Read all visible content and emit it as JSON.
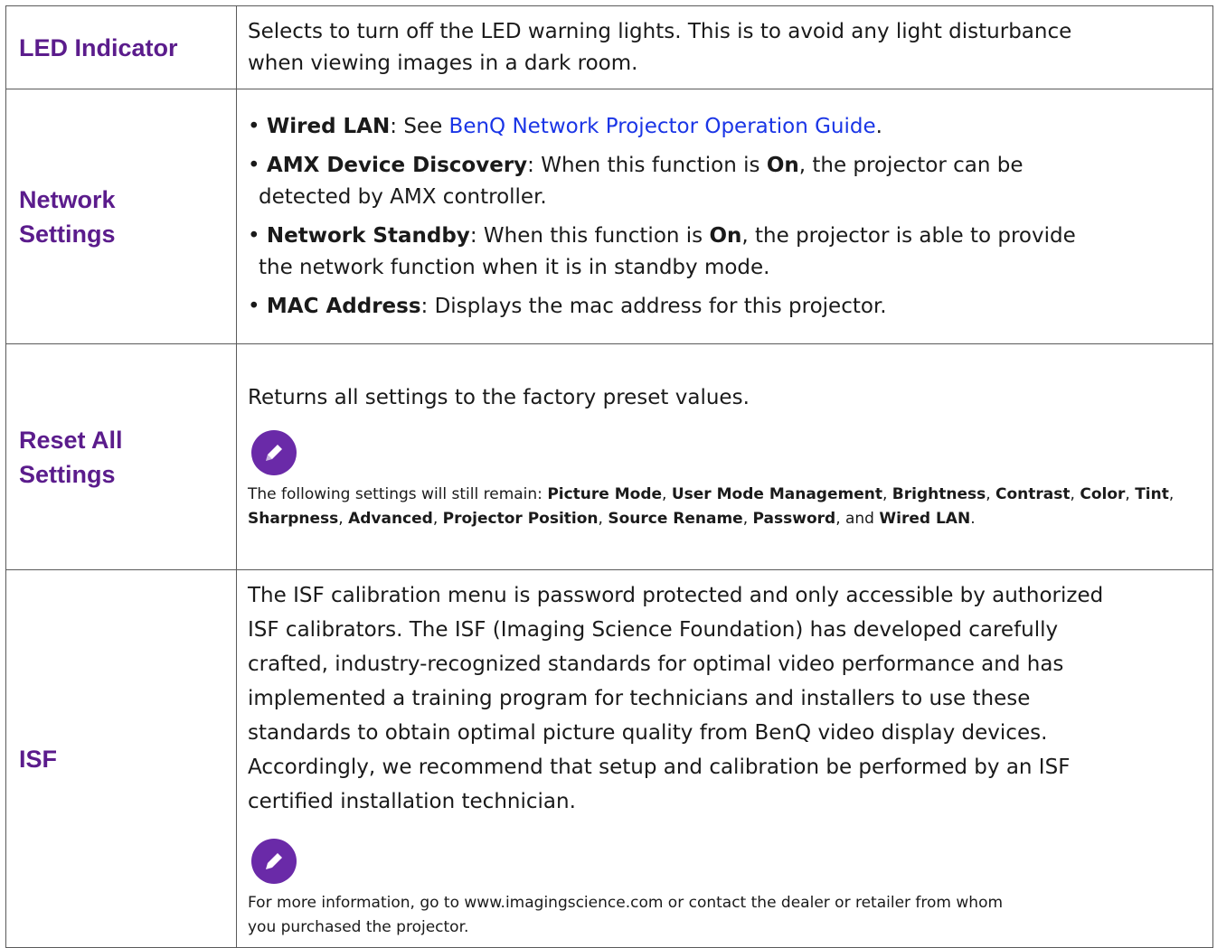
{
  "rows": {
    "led": {
      "label": "LED Indicator",
      "desc_line1": "Selects to turn off the LED warning lights. This is to avoid any light disturbance",
      "desc_line2": "when viewing images in a dark room."
    },
    "network": {
      "label_line1": "Network",
      "label_line2": "Settings",
      "wired": {
        "term": "Wired LAN",
        "text": ": See ",
        "link": "BenQ Network Projector Operation Guide",
        "end": "."
      },
      "amx": {
        "term": "AMX Device Discovery",
        "t1": ": When this function is ",
        "on": "On",
        "t2": ", the projector can be",
        "line2": "detected by AMX controller."
      },
      "standby": {
        "term": "Network Standby",
        "t1": ": When this function is ",
        "on": "On",
        "t2": ", the projector is able to provide",
        "line2": "the network function when it is in standby mode."
      },
      "mac": {
        "term": "MAC Address",
        "text": ": Displays the mac address for this projector."
      }
    },
    "reset": {
      "label_line1": "Reset All",
      "label_line2": "Settings",
      "intro": "Returns all settings to the factory preset values.",
      "note_icon": "pencil-icon",
      "note": {
        "prefix": "The following settings will still remain: ",
        "items": [
          "Picture Mode",
          "User Mode Management",
          "Brightness",
          "Contrast",
          "Color",
          "Tint",
          "Sharpness",
          "Advanced",
          "Projector Position",
          "Source Rename",
          "Password"
        ],
        "sep": ", ",
        "and": ", and ",
        "last": "Wired LAN",
        "end": "."
      }
    },
    "isf": {
      "label": "ISF",
      "lines": [
        "The ISF calibration menu is password protected and only accessible by authorized",
        "ISF calibrators. The ISF (Imaging Science Foundation) has developed carefully",
        "crafted, industry-recognized standards for optimal video performance and has",
        "implemented a training program for technicians and installers to use these",
        "standards to obtain optimal picture quality from BenQ video display devices.",
        "Accordingly, we recommend that setup and calibration be performed by an ISF",
        "certified installation technician."
      ],
      "note_icon": "pencil-icon",
      "note_line1": "For more information, go to www.imagingscience.com or contact the dealer or retailer from whom",
      "note_line2": "you purchased the projector."
    }
  },
  "colors": {
    "label": "#5b1c8c",
    "link": "#1a35e6",
    "note_icon_bg": "#6a2aa8",
    "border": "#5a5a5a"
  }
}
